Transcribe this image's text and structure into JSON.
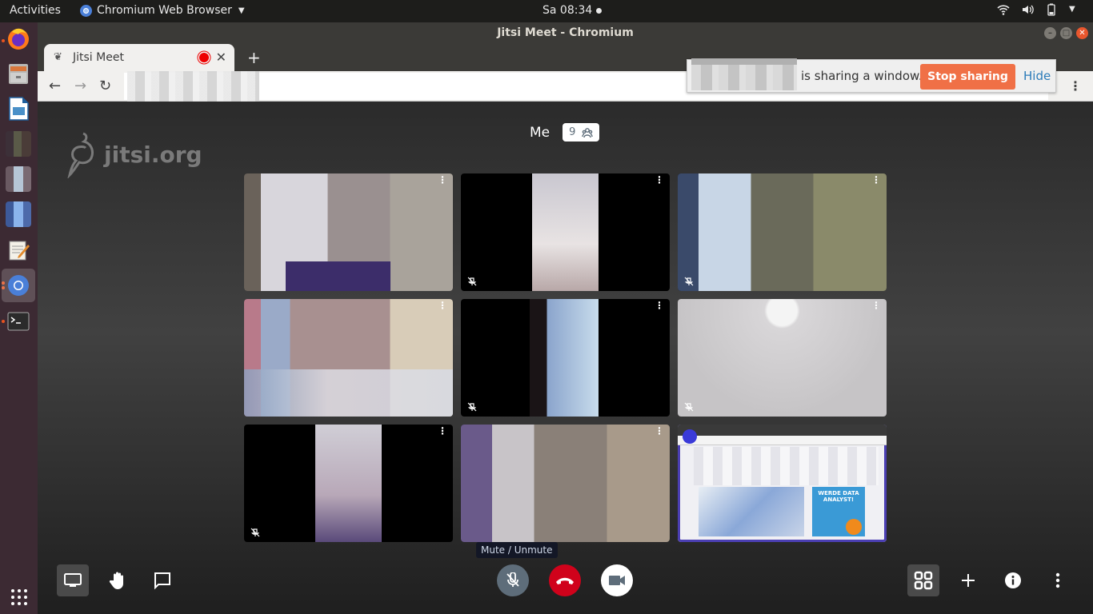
{
  "os": {
    "activities_label": "Activities",
    "app_menu_label": "Chromium Web Browser",
    "clock": "Sa 08:34",
    "tray_icons": [
      "wifi-icon",
      "volume-icon",
      "battery-icon",
      "system-menu-caret-icon"
    ],
    "launcher": [
      {
        "name": "firefox",
        "running": true
      },
      {
        "name": "files",
        "running": false
      },
      {
        "name": "libreoffice-impress",
        "running": false
      },
      {
        "name": "pixelated-app-1",
        "running": false
      },
      {
        "name": "pixelated-app-2",
        "running": false
      },
      {
        "name": "pixelated-app-3",
        "running": false
      },
      {
        "name": "text-editor",
        "running": false
      },
      {
        "name": "chromium",
        "running": true,
        "active": true
      },
      {
        "name": "terminal",
        "running": true
      }
    ],
    "show_apps_label": "Show Applications"
  },
  "browser": {
    "window_title": "Jitsi Meet - Chromium",
    "tab": {
      "title": "Jitsi Meet",
      "recording_indicator": true
    },
    "new_tab_label": "+",
    "address_redacted": true,
    "share_infobar": {
      "message": "is sharing a window.",
      "stop_label": "Stop sharing",
      "hide_label": "Hide",
      "stop_color": "#f07046",
      "hide_color": "#2b7bb9"
    }
  },
  "meeting": {
    "watermark": "jitsi.org",
    "local_name": "Me",
    "participant_count": "9",
    "tiles": [
      {
        "id": 1,
        "muted": false,
        "video": "pixelated-person"
      },
      {
        "id": 2,
        "muted": true,
        "video": "portrait-ceiling"
      },
      {
        "id": 3,
        "muted": true,
        "video": "pixelated-person"
      },
      {
        "id": 4,
        "muted": false,
        "video": "pixelated-room"
      },
      {
        "id": 5,
        "muted": true,
        "video": "portrait-doorway"
      },
      {
        "id": 6,
        "muted": true,
        "video": "ceiling-light"
      },
      {
        "id": 7,
        "muted": true,
        "video": "portrait-ceiling"
      },
      {
        "id": 8,
        "muted": false,
        "video": "pixelated-room"
      },
      {
        "id": 9,
        "muted": false,
        "video": "screen-share",
        "dominant": true,
        "ad_text": "WERDE DATA ANALYST!"
      }
    ],
    "tooltip": "Mute / Unmute",
    "toolbar": {
      "left": [
        "screen-share",
        "raise-hand",
        "chat"
      ],
      "center": [
        "microphone-muted",
        "hangup",
        "camera"
      ],
      "right": [
        "tile-view",
        "invite",
        "info",
        "more"
      ]
    },
    "colors": {
      "hangup": "#d0021b",
      "dominant_border": "#4b3fb3",
      "mic_button": "#5e6d7a"
    }
  }
}
